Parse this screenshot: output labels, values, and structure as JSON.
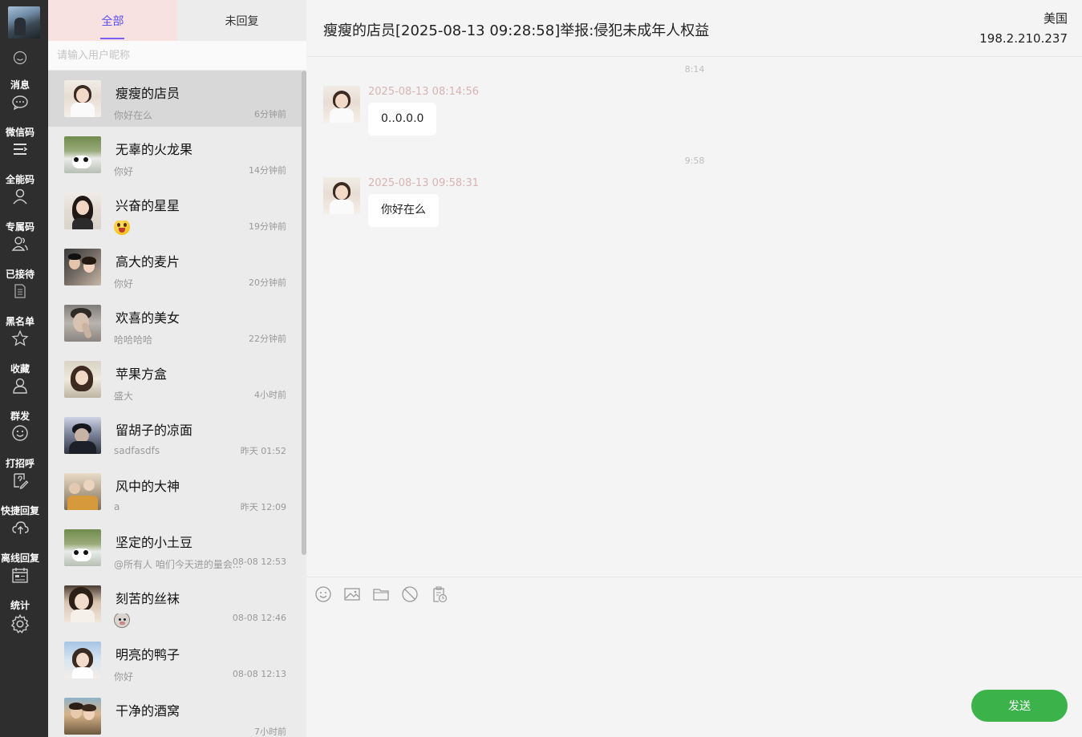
{
  "rail": {
    "items": [
      {
        "label": "消息",
        "icon": "chat-bubble-icon"
      },
      {
        "label": "微信码",
        "icon": "list-icon"
      },
      {
        "label": "全能码",
        "icon": "user-icon"
      },
      {
        "label": "专属码",
        "icon": "users-icon"
      },
      {
        "label": "已接待",
        "icon": "document-icon"
      },
      {
        "label": "黑名单",
        "icon": "star-icon"
      },
      {
        "label": "收藏",
        "icon": "person-icon"
      },
      {
        "label": "群发",
        "icon": "smile-icon"
      },
      {
        "label": "打招呼",
        "icon": "edit-icon"
      },
      {
        "label": "快捷回复",
        "icon": "cloud-upload-icon"
      },
      {
        "label": "离线回复",
        "icon": "calendar-icon"
      },
      {
        "label": "统计",
        "icon": "gear-icon"
      }
    ]
  },
  "tabs": {
    "all": "全部",
    "unreplied": "未回复"
  },
  "search": {
    "placeholder": "请输入用户昵称"
  },
  "conversations": [
    {
      "name": "瘦瘦的店员",
      "preview": "你好在么",
      "time": "6分钟前",
      "active": true
    },
    {
      "name": "无辜的火龙果",
      "preview": "你好",
      "time": "14分钟前"
    },
    {
      "name": "兴奋的星星",
      "preview": "",
      "time": "19分钟前",
      "emoji": "excited-face-emoji"
    },
    {
      "name": "高大的麦片",
      "preview": "你好",
      "time": "20分钟前"
    },
    {
      "name": "欢喜的美女",
      "preview": "哈哈哈哈",
      "time": "22分钟前"
    },
    {
      "name": "苹果方盒",
      "preview": "盛大",
      "time": "4小时前"
    },
    {
      "name": "留胡子的凉面",
      "preview": "sadfasdfs",
      "time": "昨天 01:52"
    },
    {
      "name": "风中的大神",
      "preview": "a",
      "time": "昨天 12:09"
    },
    {
      "name": "坚定的小土豆",
      "preview": "@所有人 咱们今天进的量会...",
      "time": "08-08 12:53"
    },
    {
      "name": "刻苦的丝袜",
      "preview": "",
      "time": "08-08 12:46",
      "emoji": "bear-emoji"
    },
    {
      "name": "明亮的鸭子",
      "preview": "你好",
      "time": "08-08 12:13"
    },
    {
      "name": "干净的酒窝",
      "preview": "",
      "time": "7小时前"
    }
  ],
  "chat": {
    "title": "瘦瘦的店员[2025-08-13 09:28:58]举报:侵犯未成年人权益",
    "region": "美国",
    "ip": "198.2.210.237",
    "messages": [
      {
        "divider": "8:14",
        "stamp": "2025-08-13 08:14:56",
        "text": "0..0.0.0"
      },
      {
        "divider": "9:58",
        "stamp": "2025-08-13 09:58:31",
        "text": "你好在么"
      }
    ]
  },
  "composer": {
    "tools": [
      "emoji-icon",
      "image-icon",
      "folder-icon",
      "block-icon",
      "clipboard-clock-icon"
    ],
    "send_label": "发送"
  },
  "colors": {
    "rail_bg": "#2e2e2e",
    "active_tab_bg": "#f8e1e1",
    "tab_underline": "#7b5ef2",
    "send_button": "#3cb34a",
    "timestamp": "#d9b3b3"
  }
}
